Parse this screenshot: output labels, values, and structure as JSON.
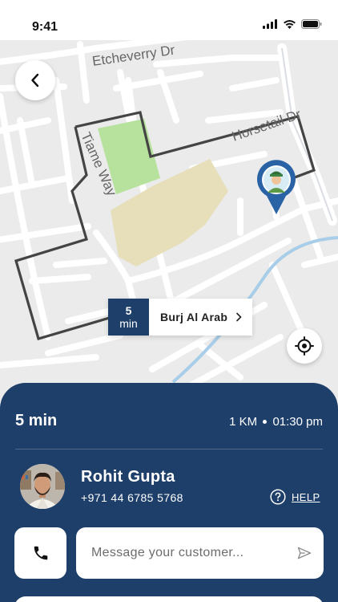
{
  "status_bar": {
    "time": "9:41"
  },
  "map": {
    "streets": [
      "Etcheverry Dr",
      "Horsetail Dr",
      "Tiame Way"
    ],
    "eta": {
      "number": "5",
      "unit": "min"
    },
    "destination": "Burj Al Arab",
    "icons": {
      "back": "chevron-left-icon",
      "locate": "crosshair-icon",
      "pin": "driver-pin-icon"
    }
  },
  "trip": {
    "duration": "5 min",
    "distance": "1 KM",
    "arrival_time": "01:30 pm"
  },
  "customer": {
    "name": "Rohit Gupta",
    "phone": "+971 44 6785 5768"
  },
  "help": {
    "label": "HELP"
  },
  "message": {
    "placeholder": "Message your customer...",
    "value": ""
  },
  "colors": {
    "primary": "#1e3f6a",
    "route": "#444444",
    "park": "#b7e29e",
    "building": "#e6dfba",
    "water": "#a8cde8"
  }
}
